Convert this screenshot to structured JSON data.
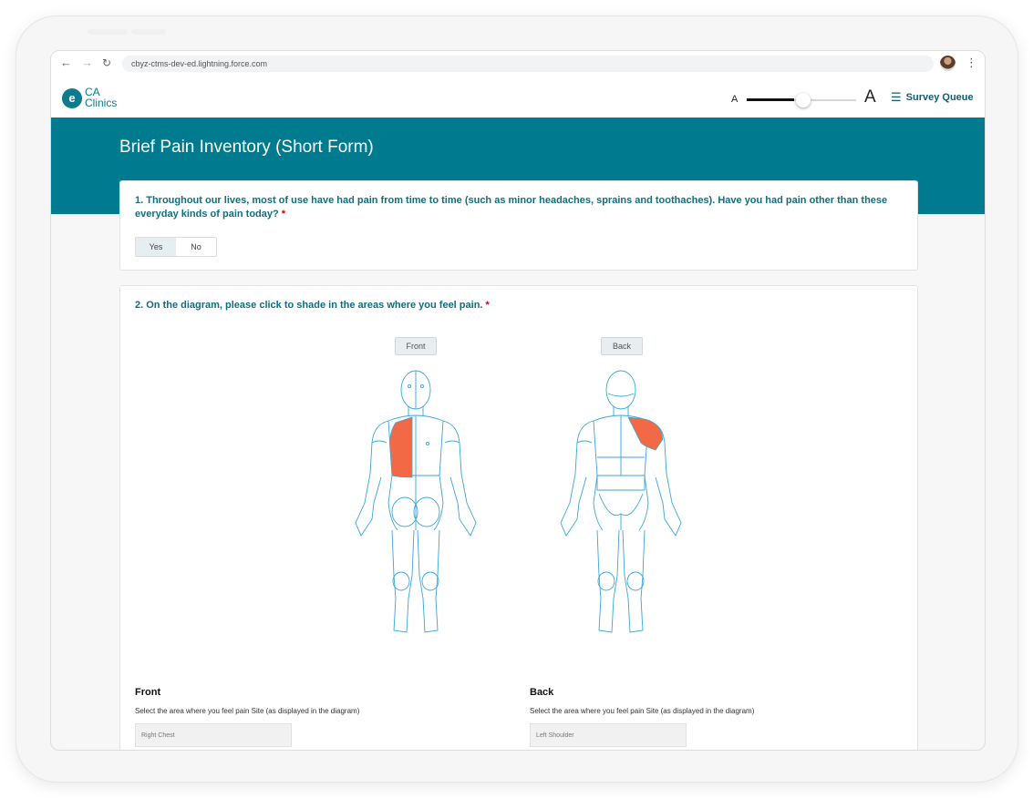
{
  "browser": {
    "url": "cbyz-ctms-dev-ed.lightning.force.com"
  },
  "header": {
    "logo_line1": "CA",
    "logo_line2": "Clinics",
    "font_small_label": "A",
    "font_large_label": "A",
    "survey_queue_label": "Survey Queue"
  },
  "form": {
    "title": "Brief Pain Inventory (Short Form)"
  },
  "q1": {
    "text": "1. Throughout our lives, most of use have had pain from time to time (such as minor headaches, sprains and toothaches). Have you had pain other than these everyday kinds of pain today?",
    "required": "*",
    "options": [
      "Yes",
      "No"
    ],
    "selected": "Yes"
  },
  "q2": {
    "text": "2. On the diagram, please click to shade in the areas where you feel pain.",
    "required": "*",
    "front_tab": "Front",
    "back_tab": "Back",
    "front_heading": "Front",
    "back_heading": "Back",
    "front_helper": "Select the area where you feel pain Site (as displayed in the diagram)",
    "back_helper": "Select the area where you feel pain Site (as displayed in the diagram)",
    "front_value": "Right Chest",
    "back_value": "Left Shoulder"
  },
  "colors": {
    "brand": "#007a8f",
    "highlight": "#f26a45",
    "outline": "#3aa6d8"
  },
  "icons": [
    "back-arrow-icon",
    "forward-arrow-icon",
    "reload-icon",
    "kebab-icon",
    "list-icon"
  ]
}
